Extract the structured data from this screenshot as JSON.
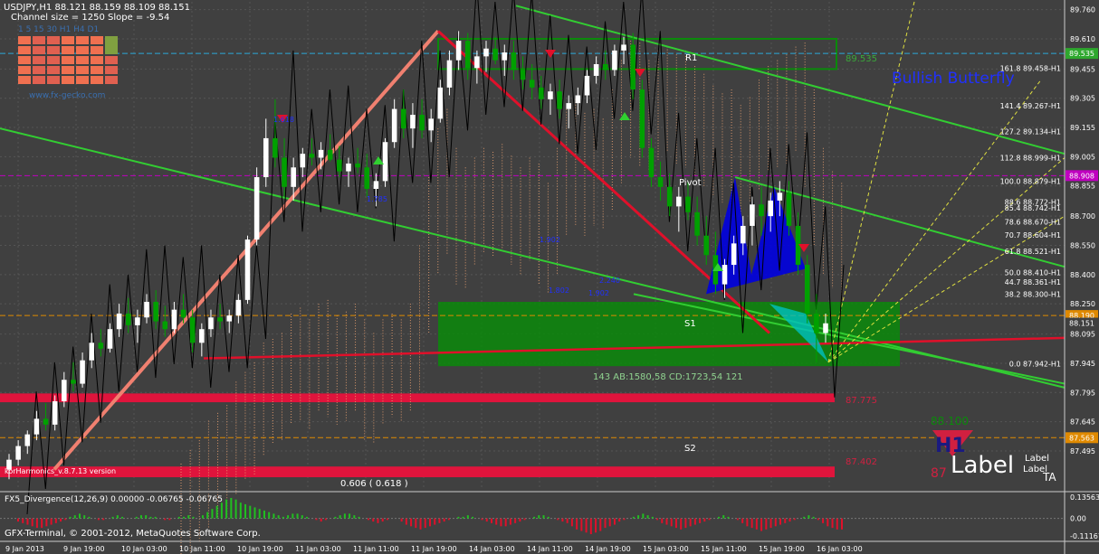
{
  "header": {
    "line1": "USDJPY,H1  88.121 88.159 88.109 88.151",
    "line2": "Channel size = 1250 Slope = -9.54"
  },
  "gecko_widget": {
    "timeframes": "1  5  15  30  H1  H4  D1",
    "website": "www.fx-gecko.com"
  },
  "price_axis": {
    "min": 87.3,
    "max": 89.8,
    "ticks": [
      "89.760",
      "89.610",
      "89.455",
      "89.305",
      "89.155",
      "89.005",
      "88.855",
      "88.700",
      "88.550",
      "88.400",
      "88.250",
      "88.095",
      "87.945",
      "87.795",
      "87.645",
      "87.495"
    ],
    "tick_values": [
      89.76,
      89.61,
      89.455,
      89.305,
      89.155,
      89.005,
      88.855,
      88.7,
      88.55,
      88.4,
      88.25,
      88.095,
      87.945,
      87.795,
      87.645,
      87.495
    ],
    "flags": [
      {
        "text": "89.535",
        "value": 89.535,
        "color": "#2ea82e"
      },
      {
        "text": "88.908",
        "value": 88.908,
        "color": "#c000c0"
      },
      {
        "text": "88.190",
        "value": 88.19,
        "color": "#e08a00"
      },
      {
        "text": "88.151",
        "value": 88.151,
        "color": "#404040"
      },
      {
        "text": "87.563",
        "value": 87.563,
        "color": "#e08a00"
      }
    ]
  },
  "time_axis": {
    "labels": [
      "9 Jan 2013",
      "9 Jan 19:00",
      "10 Jan 03:00",
      "10 Jan 11:00",
      "10 Jan 19:00",
      "11 Jan 03:00",
      "11 Jan 11:00",
      "11 Jan 19:00",
      "14 Jan 03:00",
      "14 Jan 11:00",
      "14 Jan 19:00",
      "15 Jan 03:00",
      "15 Jan 11:00",
      "15 Jan 19:00",
      "16 Jan 03:00"
    ]
  },
  "annotations": {
    "pattern": "Bullish Butterfly",
    "pivot": "Pivot",
    "r1": "R1",
    "s1": "S1",
    "s2": "S2",
    "harmonic_stats": "143   AB:1580,58 CD:1723,54   121",
    "indicator_name": "korHarmonics_v.8.7.13 version",
    "fib_ratio": "0.606 ( 0.618 )",
    "zone_labels": [
      "89.535",
      "87.775",
      "87.402"
    ],
    "wave_labels": [
      "1.618",
      "1.902",
      "1.902",
      "1.802",
      "2.240",
      "1.785"
    ],
    "h1_label": "H1",
    "big_label": "Label",
    "small_label": "Label",
    "small_label2": "Label",
    "corner": "TA",
    "mini_value": "88.100",
    "mini_value2": "87"
  },
  "fib_levels": [
    {
      "text": "161.8 89.458-H1",
      "value": 89.458
    },
    {
      "text": "141.4 89.267-H1",
      "value": 89.267
    },
    {
      "text": "127.2 89.134-H1",
      "value": 89.134
    },
    {
      "text": "112.8 88.999-H1",
      "value": 88.999
    },
    {
      "text": "100.0 88.879-H1",
      "value": 88.879
    },
    {
      "text": "88.6 88.772-H1",
      "value": 88.772
    },
    {
      "text": "85.4 88.742-H1",
      "value": 88.742
    },
    {
      "text": "78.6 88.670-H1",
      "value": 88.67
    },
    {
      "text": "70.7 88.604-H1",
      "value": 88.604
    },
    {
      "text": "61.8 88.521-H1",
      "value": 88.521
    },
    {
      "text": "50.0 88.410-H1",
      "value": 88.41
    },
    {
      "text": "44.7 88.361-H1",
      "value": 88.361
    },
    {
      "text": "38.2 88.300-H1",
      "value": 88.3
    },
    {
      "text": "0.0 87.942-H1",
      "value": 87.942
    }
  ],
  "oscillator": {
    "title": "FX5_Divergence(12,26,9) 0.00000 -0.06765 -0.06765",
    "ticks": [
      "0.13563",
      "0.00",
      "-0.11167"
    ],
    "tick_values": [
      0.13563,
      0.0,
      -0.11167
    ],
    "min": -0.14,
    "max": 0.17,
    "values": [
      -0.02,
      -0.03,
      -0.04,
      -0.05,
      -0.06,
      -0.06,
      -0.05,
      -0.04,
      -0.03,
      -0.02,
      -0.01,
      0.01,
      0.02,
      0.03,
      0.02,
      0.01,
      0.0,
      -0.01,
      -0.01,
      0.0,
      0.01,
      0.02,
      0.01,
      0.0,
      0.0,
      0.01,
      0.02,
      0.02,
      0.01,
      0.01,
      0.0,
      -0.01,
      -0.01,
      0.0,
      0.01,
      0.01,
      0.02,
      0.01,
      0.0,
      0.02,
      0.04,
      0.06,
      0.08,
      0.1,
      0.12,
      0.13,
      0.12,
      0.1,
      0.09,
      0.08,
      0.07,
      0.06,
      0.05,
      0.04,
      0.03,
      0.02,
      0.01,
      0.02,
      0.03,
      0.03,
      0.02,
      0.01,
      0.0,
      -0.01,
      -0.02,
      -0.01,
      0.0,
      0.01,
      0.02,
      0.03,
      0.03,
      0.02,
      0.01,
      0.0,
      -0.01,
      -0.02,
      -0.03,
      -0.02,
      -0.01,
      0.0,
      0.0,
      -0.02,
      -0.04,
      -0.05,
      -0.06,
      -0.07,
      -0.06,
      -0.05,
      -0.04,
      -0.03,
      -0.02,
      -0.01,
      0.0,
      0.01,
      0.01,
      0.02,
      0.01,
      0.0,
      -0.01,
      -0.02,
      -0.03,
      -0.04,
      -0.05,
      -0.05,
      -0.04,
      -0.03,
      -0.02,
      -0.01,
      0.0,
      0.01,
      0.02,
      0.02,
      0.01,
      0.0,
      -0.01,
      -0.02,
      -0.03,
      -0.05,
      -0.07,
      -0.08,
      -0.09,
      -0.1,
      -0.09,
      -0.08,
      -0.06,
      -0.05,
      -0.04,
      -0.02,
      -0.01,
      0.0,
      0.01,
      0.02,
      0.03,
      0.02,
      0.01,
      -0.01,
      -0.03,
      -0.04,
      -0.05,
      -0.06,
      -0.07,
      -0.06,
      -0.05,
      -0.04,
      -0.03,
      -0.02,
      -0.01,
      0.0,
      0.01,
      0.02,
      0.01,
      0.0,
      -0.01,
      -0.03,
      -0.05,
      -0.06,
      -0.07,
      -0.08,
      -0.07,
      -0.06,
      -0.05,
      -0.04,
      -0.03,
      -0.02,
      -0.01,
      0.0,
      0.01,
      0.02,
      0.01,
      -0.01,
      -0.03,
      -0.05,
      -0.06,
      -0.07,
      -0.07
    ]
  },
  "footer": {
    "copyright": "GFX-Terminal, © 2001-2012, MetaQuotes Software Corp."
  },
  "colors": {
    "background": "#404040",
    "grid": "#555555",
    "bull_candle": "#ffffff",
    "bear_candle": "#00a000",
    "channel": "#32cd32",
    "pattern_fill": "#0000e0",
    "resistance_zone": "#0a8a0a",
    "support_zone": "#e0143c",
    "uptrend": "#f08070"
  },
  "chart_data": {
    "type": "candlestick",
    "symbol": "USDJPY",
    "timeframe": "H1",
    "ylim": [
      87.3,
      89.8
    ],
    "ohlc": [
      [
        87.4,
        87.48,
        87.35,
        87.45
      ],
      [
        87.45,
        87.55,
        87.42,
        87.52
      ],
      [
        87.52,
        87.6,
        87.48,
        87.58
      ],
      [
        87.58,
        87.7,
        87.55,
        87.66
      ],
      [
        87.66,
        87.74,
        87.6,
        87.63
      ],
      [
        87.63,
        87.78,
        87.6,
        87.75
      ],
      [
        87.75,
        87.9,
        87.72,
        87.86
      ],
      [
        87.86,
        87.95,
        87.8,
        87.84
      ],
      [
        87.84,
        88.0,
        87.82,
        87.96
      ],
      [
        87.96,
        88.1,
        87.92,
        88.05
      ],
      [
        88.05,
        88.12,
        87.98,
        88.02
      ],
      [
        88.02,
        88.15,
        88.0,
        88.12
      ],
      [
        88.12,
        88.25,
        88.08,
        88.2
      ],
      [
        88.2,
        88.28,
        88.1,
        88.14
      ],
      [
        88.14,
        88.22,
        88.05,
        88.18
      ],
      [
        88.18,
        88.3,
        88.15,
        88.26
      ],
      [
        88.26,
        88.32,
        88.12,
        88.16
      ],
      [
        88.16,
        88.24,
        88.08,
        88.12
      ],
      [
        88.12,
        88.26,
        88.1,
        88.22
      ],
      [
        88.22,
        88.3,
        88.15,
        88.18
      ],
      [
        88.18,
        88.22,
        88.0,
        88.05
      ],
      [
        88.05,
        88.15,
        87.98,
        88.12
      ],
      [
        88.12,
        88.22,
        88.08,
        88.18
      ],
      [
        88.18,
        88.25,
        88.12,
        88.16
      ],
      [
        88.16,
        88.22,
        88.1,
        88.19
      ],
      [
        88.19,
        88.3,
        88.15,
        88.27
      ],
      [
        88.27,
        88.6,
        88.25,
        88.58
      ],
      [
        88.58,
        88.95,
        88.55,
        88.9
      ],
      [
        88.9,
        89.2,
        88.85,
        89.1
      ],
      [
        89.1,
        89.3,
        88.95,
        89.0
      ],
      [
        89.0,
        89.1,
        88.8,
        88.85
      ],
      [
        88.85,
        89.0,
        88.78,
        88.95
      ],
      [
        88.95,
        89.05,
        88.9,
        89.02
      ],
      [
        89.02,
        89.1,
        88.96,
        89.0
      ],
      [
        89.0,
        89.08,
        88.94,
        89.04
      ],
      [
        89.04,
        89.12,
        88.98,
        88.99
      ],
      [
        88.99,
        89.06,
        88.9,
        88.93
      ],
      [
        88.93,
        89.0,
        88.85,
        88.97
      ],
      [
        88.97,
        89.05,
        88.92,
        88.95
      ],
      [
        88.95,
        89.02,
        88.8,
        88.84
      ],
      [
        88.84,
        88.92,
        88.75,
        88.88
      ],
      [
        88.88,
        89.1,
        88.85,
        89.08
      ],
      [
        89.08,
        89.3,
        89.05,
        89.25
      ],
      [
        89.25,
        89.35,
        89.1,
        89.15
      ],
      [
        89.15,
        89.28,
        89.05,
        89.22
      ],
      [
        89.22,
        89.3,
        89.1,
        89.14
      ],
      [
        89.14,
        89.25,
        89.08,
        89.2
      ],
      [
        89.2,
        89.4,
        89.18,
        89.36
      ],
      [
        89.36,
        89.55,
        89.32,
        89.5
      ],
      [
        89.5,
        89.65,
        89.45,
        89.6
      ],
      [
        89.6,
        89.64,
        89.4,
        89.46
      ],
      [
        89.46,
        89.55,
        89.38,
        89.52
      ],
      [
        89.52,
        89.6,
        89.44,
        89.56
      ],
      [
        89.56,
        89.62,
        89.48,
        89.5
      ],
      [
        89.5,
        89.58,
        89.42,
        89.54
      ],
      [
        89.54,
        89.6,
        89.4,
        89.45
      ],
      [
        89.45,
        89.52,
        89.35,
        89.4
      ],
      [
        89.4,
        89.48,
        89.3,
        89.36
      ],
      [
        89.36,
        89.42,
        89.25,
        89.3
      ],
      [
        89.3,
        89.38,
        89.22,
        89.34
      ],
      [
        89.34,
        89.4,
        89.2,
        89.25
      ],
      [
        89.25,
        89.32,
        89.15,
        89.28
      ],
      [
        89.28,
        89.36,
        89.22,
        89.32
      ],
      [
        89.32,
        89.45,
        89.28,
        89.42
      ],
      [
        89.42,
        89.52,
        89.38,
        89.48
      ],
      [
        89.48,
        89.55,
        89.4,
        89.45
      ],
      [
        89.45,
        89.58,
        89.42,
        89.55
      ],
      [
        89.55,
        89.62,
        89.48,
        89.58
      ],
      [
        89.58,
        89.64,
        89.3,
        89.35
      ],
      [
        89.35,
        89.4,
        89.0,
        89.05
      ],
      [
        89.05,
        89.1,
        88.85,
        88.9
      ],
      [
        88.9,
        88.98,
        88.78,
        88.85
      ],
      [
        88.85,
        88.92,
        88.7,
        88.75
      ],
      [
        88.75,
        88.85,
        88.62,
        88.8
      ],
      [
        88.8,
        88.88,
        88.68,
        88.72
      ],
      [
        88.72,
        88.8,
        88.55,
        88.6
      ],
      [
        88.6,
        88.7,
        88.45,
        88.5
      ],
      [
        88.5,
        88.62,
        88.3,
        88.35
      ],
      [
        88.35,
        88.48,
        88.28,
        88.45
      ],
      [
        88.45,
        88.6,
        88.4,
        88.56
      ],
      [
        88.56,
        88.7,
        88.5,
        88.65
      ],
      [
        88.65,
        88.8,
        88.55,
        88.76
      ],
      [
        88.76,
        88.85,
        88.6,
        88.7
      ],
      [
        88.7,
        88.82,
        88.62,
        88.78
      ],
      [
        88.78,
        88.88,
        88.7,
        88.82
      ],
      [
        88.82,
        88.88,
        88.6,
        88.65
      ],
      [
        88.65,
        88.72,
        88.4,
        88.45
      ],
      [
        88.45,
        88.5,
        88.15,
        88.2
      ],
      [
        88.2,
        88.3,
        87.95,
        88.1
      ],
      [
        88.1,
        88.2,
        88.05,
        88.15
      ]
    ]
  }
}
